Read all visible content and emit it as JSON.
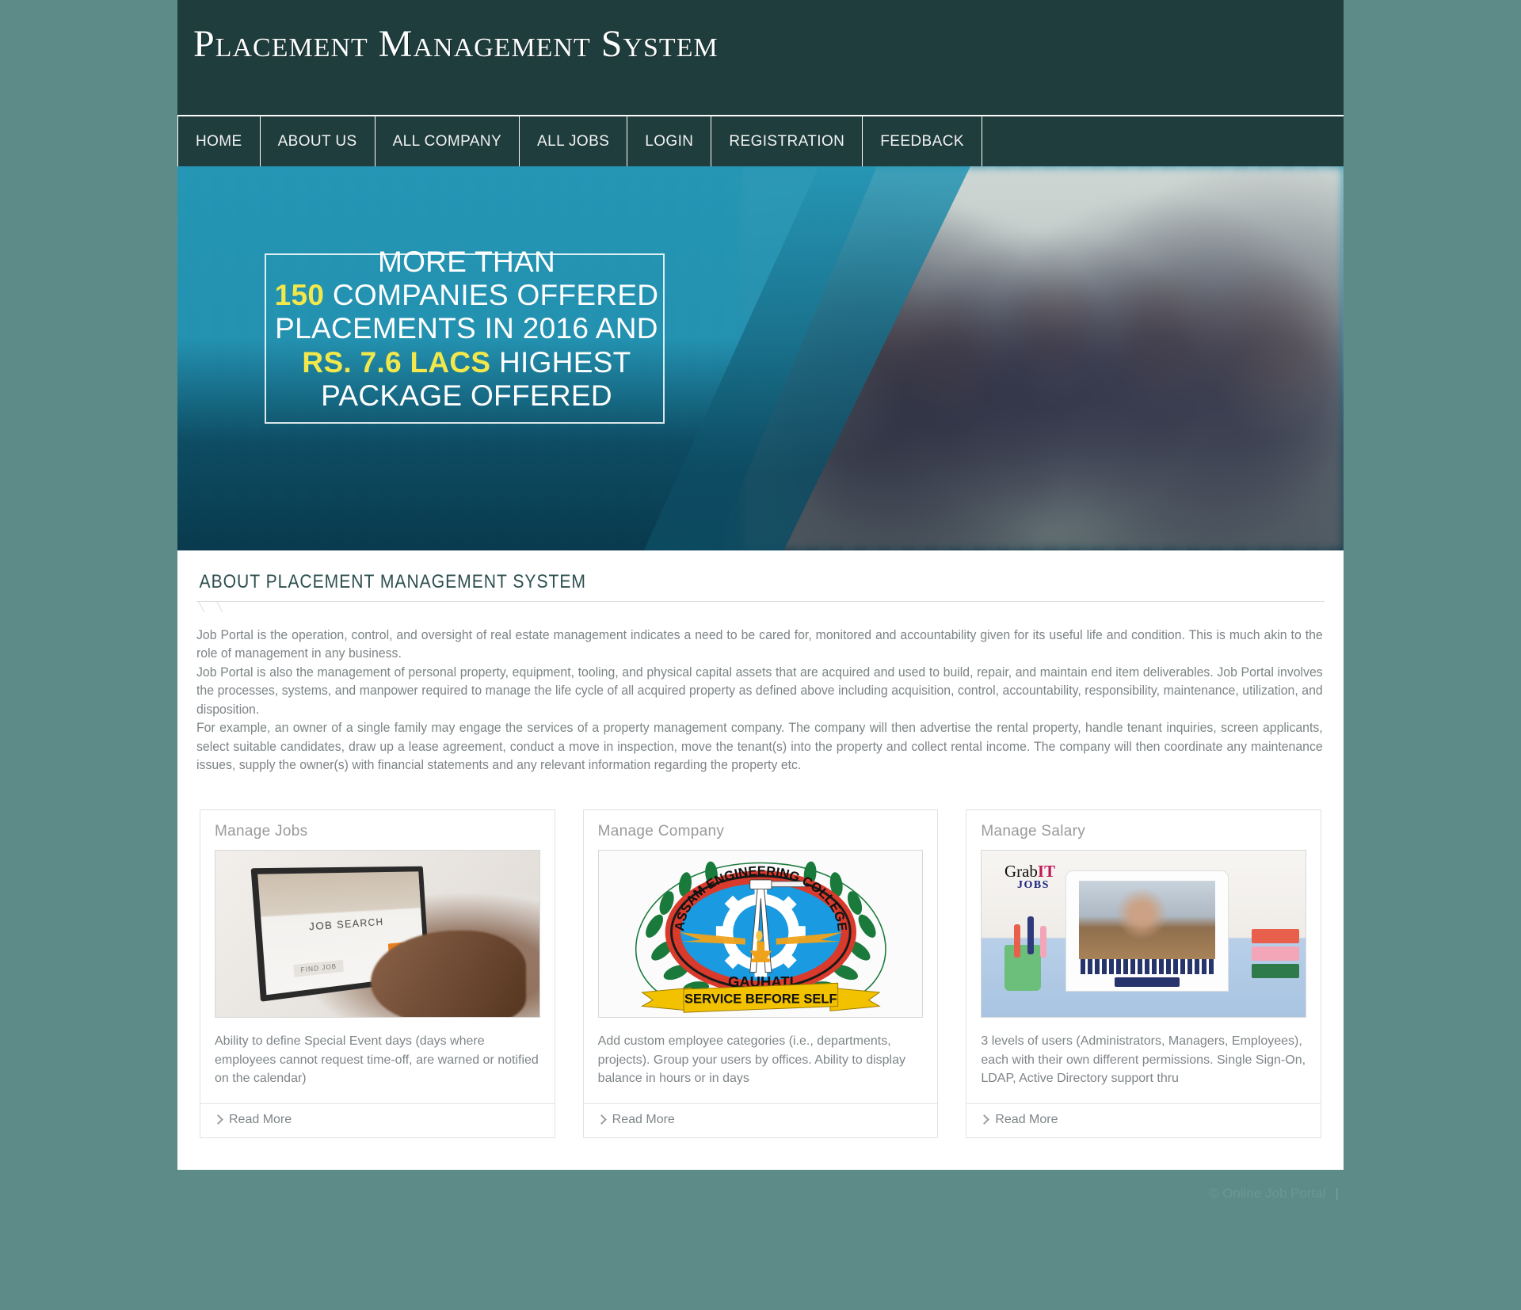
{
  "header": {
    "title": "Placement Management System"
  },
  "nav": {
    "items": [
      {
        "label": "Home",
        "name": "nav-item-home"
      },
      {
        "label": "About Us",
        "name": "nav-item-about-us"
      },
      {
        "label": "All Company",
        "name": "nav-item-all-company"
      },
      {
        "label": "All Jobs",
        "name": "nav-item-all-jobs"
      },
      {
        "label": "Login",
        "name": "nav-item-login"
      },
      {
        "label": "Registration",
        "name": "nav-item-registration"
      },
      {
        "label": "Feedback",
        "name": "nav-item-feedback"
      }
    ]
  },
  "banner": {
    "line1": "MORE THAN",
    "line2_highlight": "150",
    "line2_rest": " COMPANIES OFFERED",
    "line3": "PLACEMENTS IN 2016 AND",
    "line4_highlight": "RS. 7.6 LACS",
    "line4_rest": " HIGHEST",
    "line5": "PACKAGE OFFERED"
  },
  "about": {
    "heading": "About Placement Management System",
    "paragraphs": [
      "Job Portal is the operation, control, and oversight of real estate management indicates a need to be cared for, monitored and accountability given for its useful life and condition. This is much akin to the role of management in any business.",
      "Job Portal is also the management of personal property, equipment, tooling, and physical capital assets that are acquired and used to build, repair, and maintain end item deliverables. Job Portal involves the processes, systems, and manpower required to manage the life cycle of all acquired property as defined above including acquisition, control, accountability, responsibility, maintenance, utilization, and disposition.",
      "For example, an owner of a single family may engage the services of a property management company. The company will then advertise the rental property, handle tenant inquiries, screen applicants, select suitable candidates, draw up a lease agreement, conduct a move in inspection, move the tenant(s) into the property and collect rental income. The company will then coordinate any maintenance issues, supply the owner(s) with financial statements and any relevant information regarding the property etc."
    ]
  },
  "cards": [
    {
      "title": "Manage Jobs",
      "text": "Ability to define Special Event days (days where employees cannot request time-off, are warned or notified on the calendar)",
      "read_more": "Read More",
      "image_name": "job-search-laptop-image",
      "image_text": {
        "screen_title": "JOB SEARCH",
        "screen_button": "FIND JOB"
      }
    },
    {
      "title": "Manage Company",
      "text": "Add custom employee categories (i.e., departments, projects). Group your users by offices. Ability to display balance in hours or in days",
      "read_more": "Read More",
      "image_name": "assam-engineering-college-logo",
      "image_text": {
        "ring": "ASSAM ENGINEERING COLLEGE",
        "city": "GAUHATI",
        "motto": "SERVICE BEFORE SELF"
      }
    },
    {
      "title": "Manage Salary",
      "text": "3 levels of users (Administrators, Managers, Employees), each with their own different permissions. Single Sign-On, LDAP, Active Directory support thru",
      "read_more": "Read More",
      "image_name": "grabit-jobs-laptop-image",
      "image_text": {
        "brand_1": "Grab",
        "brand_2": "IT",
        "brand_3": "JOBS"
      }
    }
  ],
  "footer": {
    "copyright": "© Online Job Portal",
    "separator": "|"
  },
  "colors": {
    "page_background": "#5d8b88",
    "header_background": "#1e3d3c",
    "banner_teal": "#2596b5",
    "banner_highlight": "#f2e84b",
    "heading_text": "#2d4f4e",
    "body_text": "#7d8486"
  }
}
